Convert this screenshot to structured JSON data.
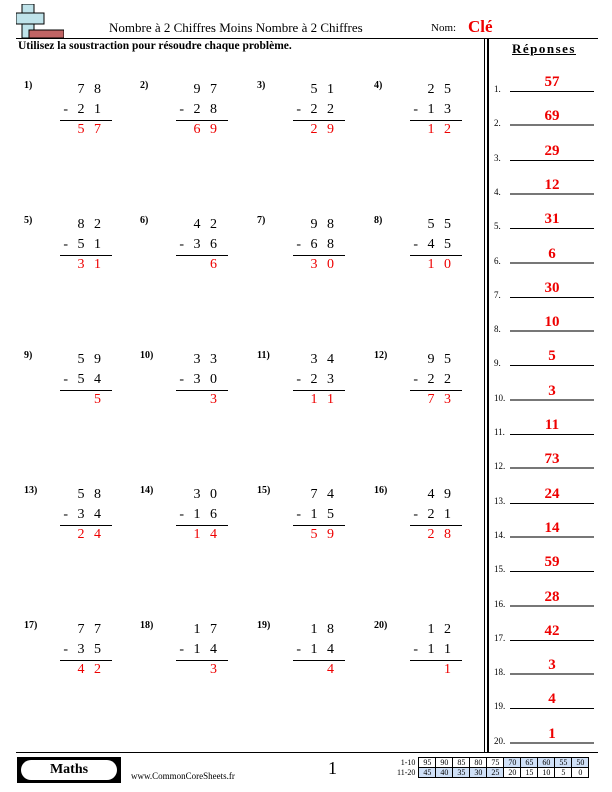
{
  "header": {
    "title": "Nombre à 2 Chiffres Moins Nombre à 2 Chiffres",
    "name_label": "Nom:",
    "name_value": "Clé",
    "logo_icon": "plus-minus-logo-icon"
  },
  "instructions": "Utilisez la soustraction pour résoudre chaque problème.",
  "problems": [
    {
      "label": "1)",
      "minuend": "7 8",
      "subtrahend": "- 2 1",
      "answer": "5 7"
    },
    {
      "label": "2)",
      "minuend": "9 7",
      "subtrahend": "- 2 8",
      "answer": "6 9"
    },
    {
      "label": "3)",
      "minuend": "5 1",
      "subtrahend": "- 2 2",
      "answer": "2 9"
    },
    {
      "label": "4)",
      "minuend": "2 5",
      "subtrahend": "- 1 3",
      "answer": "1 2"
    },
    {
      "label": "5)",
      "minuend": "8 2",
      "subtrahend": "- 5 1",
      "answer": "3 1"
    },
    {
      "label": "6)",
      "minuend": "4 2",
      "subtrahend": "- 3 6",
      "answer": "6"
    },
    {
      "label": "7)",
      "minuend": "9 8",
      "subtrahend": "- 6 8",
      "answer": "3 0"
    },
    {
      "label": "8)",
      "minuend": "5 5",
      "subtrahend": "- 4 5",
      "answer": "1 0"
    },
    {
      "label": "9)",
      "minuend": "5 9",
      "subtrahend": "- 5 4",
      "answer": "5"
    },
    {
      "label": "10)",
      "minuend": "3 3",
      "subtrahend": "- 3 0",
      "answer": "3"
    },
    {
      "label": "11)",
      "minuend": "3 4",
      "subtrahend": "- 2 3",
      "answer": "1 1"
    },
    {
      "label": "12)",
      "minuend": "9 5",
      "subtrahend": "- 2 2",
      "answer": "7 3"
    },
    {
      "label": "13)",
      "minuend": "5 8",
      "subtrahend": "- 3 4",
      "answer": "2 4"
    },
    {
      "label": "14)",
      "minuend": "3 0",
      "subtrahend": "- 1 6",
      "answer": "1 4"
    },
    {
      "label": "15)",
      "minuend": "7 4",
      "subtrahend": "- 1 5",
      "answer": "5 9"
    },
    {
      "label": "16)",
      "minuend": "4 9",
      "subtrahend": "- 2 1",
      "answer": "2 8"
    },
    {
      "label": "17)",
      "minuend": "7 7",
      "subtrahend": "- 3 5",
      "answer": "4 2"
    },
    {
      "label": "18)",
      "minuend": "1 7",
      "subtrahend": "- 1 4",
      "answer": "3"
    },
    {
      "label": "19)",
      "minuend": "1 8",
      "subtrahend": "- 1 4",
      "answer": "4"
    },
    {
      "label": "20)",
      "minuend": "1 2",
      "subtrahend": "- 1 1",
      "answer": "1"
    }
  ],
  "answers_panel": {
    "title": "Réponses",
    "items": [
      {
        "num": "1.",
        "value": "57"
      },
      {
        "num": "2.",
        "value": "69"
      },
      {
        "num": "3.",
        "value": "29"
      },
      {
        "num": "4.",
        "value": "12"
      },
      {
        "num": "5.",
        "value": "31"
      },
      {
        "num": "6.",
        "value": "6"
      },
      {
        "num": "7.",
        "value": "30"
      },
      {
        "num": "8.",
        "value": "10"
      },
      {
        "num": "9.",
        "value": "5"
      },
      {
        "num": "10.",
        "value": "3"
      },
      {
        "num": "11.",
        "value": "11"
      },
      {
        "num": "12.",
        "value": "73"
      },
      {
        "num": "13.",
        "value": "24"
      },
      {
        "num": "14.",
        "value": "14"
      },
      {
        "num": "15.",
        "value": "59"
      },
      {
        "num": "16.",
        "value": "28"
      },
      {
        "num": "17.",
        "value": "42"
      },
      {
        "num": "18.",
        "value": "3"
      },
      {
        "num": "19.",
        "value": "4"
      },
      {
        "num": "20.",
        "value": "1"
      }
    ]
  },
  "footer": {
    "subject": "Maths",
    "site": "www.CommonCoreSheets.fr",
    "page": "1",
    "score_table": [
      {
        "label": "1-10",
        "values": [
          "95",
          "90",
          "85",
          "80",
          "75",
          "70",
          "65",
          "60",
          "55",
          "50"
        ],
        "highlight_from": 5,
        "highlight_to": 9
      },
      {
        "label": "11-20",
        "values": [
          "45",
          "40",
          "35",
          "30",
          "25",
          "20",
          "15",
          "10",
          "5",
          "0"
        ],
        "highlight_from": 0,
        "highlight_to": 4
      }
    ]
  },
  "colors": {
    "answer_red": "#ee0000",
    "score_blue": "#cfe0f7"
  }
}
